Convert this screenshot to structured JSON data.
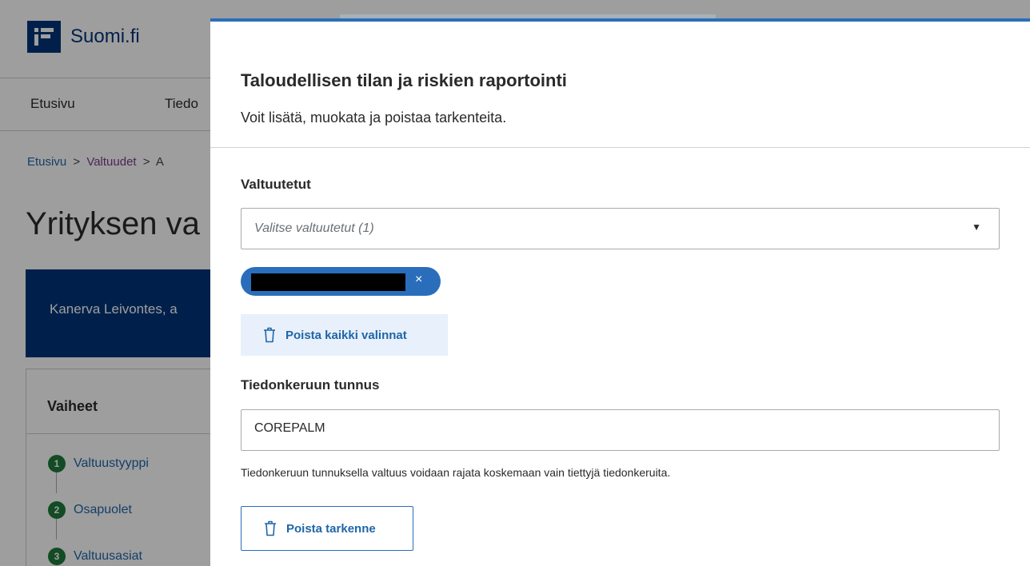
{
  "background": {
    "logo_text": "Suomi.fi",
    "nav": [
      "Etusivu",
      "Tiedo"
    ],
    "breadcrumb": [
      "Etusivu",
      "Valtuudet",
      "A"
    ],
    "breadcrumb_sep": ">",
    "page_title": "Yrityksen va",
    "banner_text": "Kanerva Leivontes, a",
    "steps_title": "Vaiheet",
    "steps": [
      {
        "num": "1",
        "label": "Valtuustyyppi"
      },
      {
        "num": "2",
        "label": "Osapuolet"
      },
      {
        "num": "3",
        "label": "Valtuusasiat"
      }
    ]
  },
  "modal": {
    "title": "Taloudellisen tilan ja riskien raportointi",
    "subtitle": "Voit lisätä, muokata ja poistaa tarkenteita.",
    "authorized": {
      "label": "Valtuutetut",
      "placeholder": "Valitse valtuutetut (1)",
      "chip_close": "×",
      "clear_all_label": "Poista kaikki valinnat"
    },
    "collection_id": {
      "label": "Tiedonkeruun tunnus",
      "value": "COREPALM",
      "hint": "Tiedonkeruun tunnuksella valtuus voidaan rajata koskemaan vain tiettyjä tiedonkeruita."
    },
    "remove_label": "Poista tarkenne"
  },
  "colors": {
    "brand": "#003479",
    "accent": "#2a6ebb",
    "link": "#1f66a8",
    "step_done": "#1f7a3a"
  }
}
